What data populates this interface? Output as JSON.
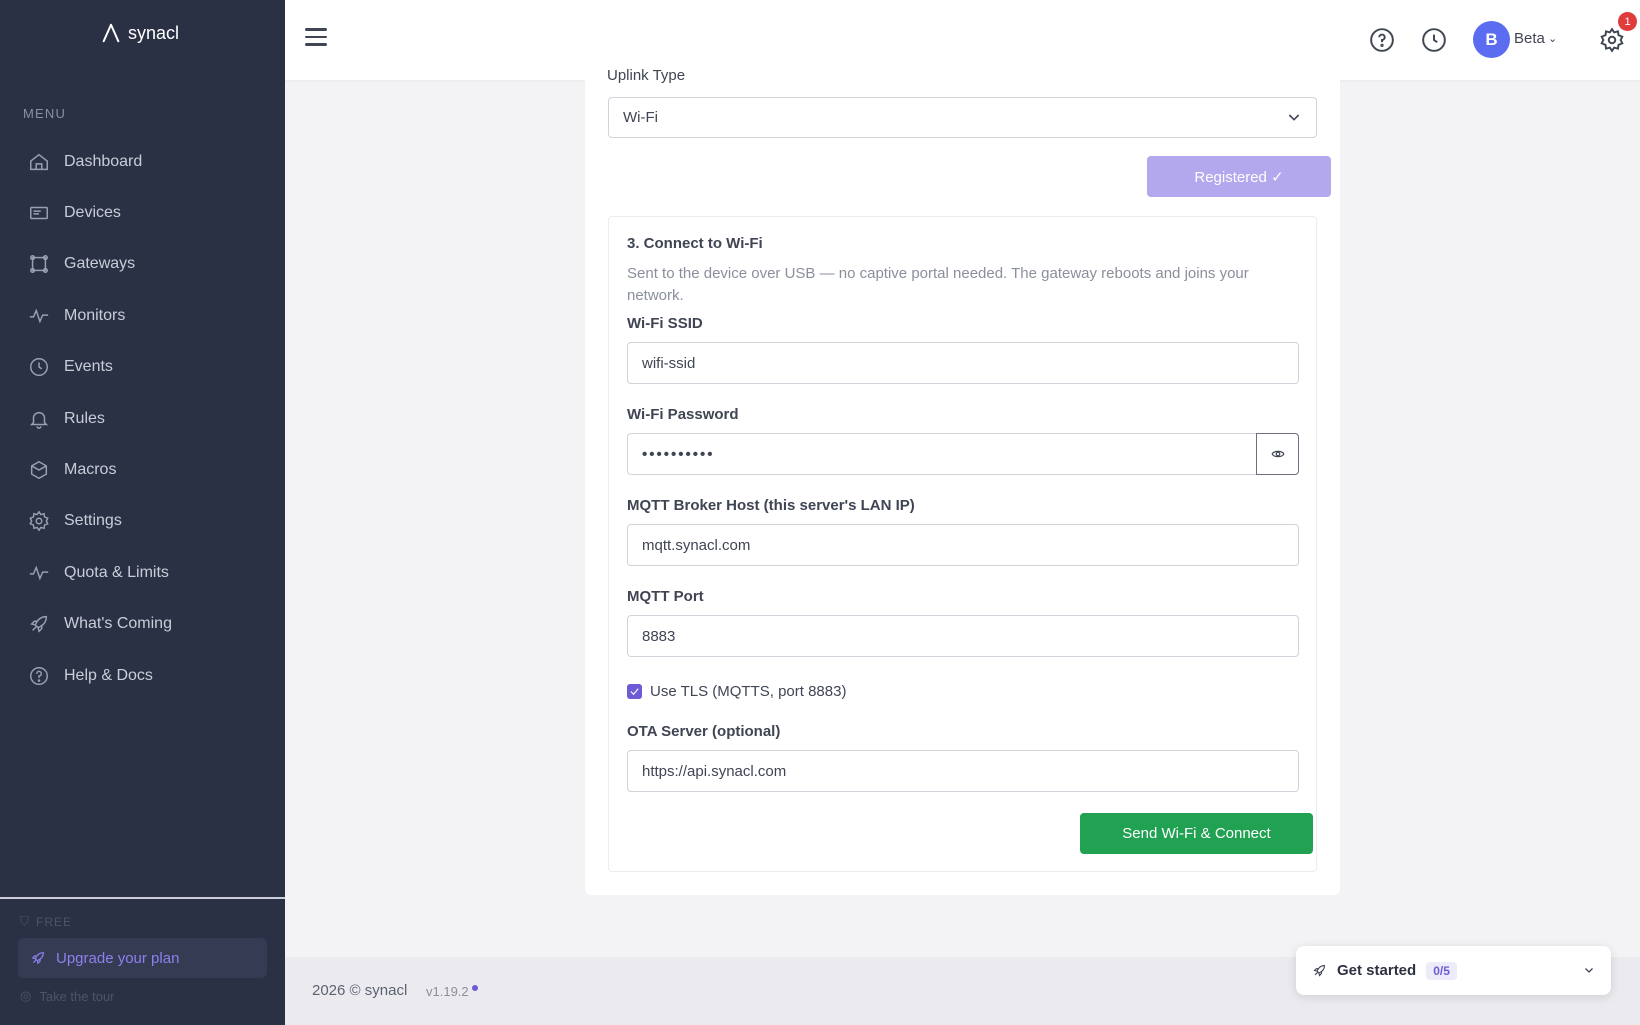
{
  "brand": {
    "name": "synacl"
  },
  "sidebar": {
    "menu_label": "MENU",
    "items": [
      {
        "label": "Dashboard",
        "icon": "home-icon"
      },
      {
        "label": "Devices",
        "icon": "devices-icon"
      },
      {
        "label": "Gateways",
        "icon": "gateway-icon"
      },
      {
        "label": "Monitors",
        "icon": "activity-icon"
      },
      {
        "label": "Events",
        "icon": "clock-icon"
      },
      {
        "label": "Rules",
        "icon": "bell-icon"
      },
      {
        "label": "Macros",
        "icon": "hexagon-icon"
      },
      {
        "label": "Settings",
        "icon": "gear-icon"
      },
      {
        "label": "Quota & Limits",
        "icon": "activity-icon"
      },
      {
        "label": "What's Coming",
        "icon": "rocket-icon"
      },
      {
        "label": "Help & Docs",
        "icon": "help-icon"
      }
    ],
    "plan_tier": "FREE",
    "upgrade_label": "Upgrade your plan",
    "tour_label": "Take the tour"
  },
  "topbar": {
    "user_initial": "B",
    "user_name": "Beta",
    "notification_count": "1"
  },
  "form": {
    "uplink_label": "Uplink Type",
    "uplink_value": "Wi-Fi",
    "registered_label": "Registered ✓",
    "step_title": "3. Connect to Wi-Fi",
    "step_desc": "Sent to the device over USB — no captive portal needed. The gateway reboots and joins your network.",
    "ssid_label": "Wi-Fi SSID",
    "ssid_value": "wifi-ssid",
    "password_label": "Wi-Fi Password",
    "password_value": "••••••••••",
    "broker_label": "MQTT Broker Host (this server's LAN IP)",
    "broker_value": "mqtt.synacl.com",
    "port_label": "MQTT Port",
    "port_value": "8883",
    "tls_label": "Use TLS (MQTTS, port 8883)",
    "tls_checked": true,
    "ota_label": "OTA Server (optional)",
    "ota_value": "https://api.synacl.com",
    "send_label": "Send Wi-Fi & Connect"
  },
  "footer": {
    "copyright": "2026 © synacl",
    "version": "v1.19.2"
  },
  "get_started": {
    "label": "Get started",
    "progress": "0/5"
  },
  "colors": {
    "sidebar_bg": "#2b3145",
    "accent": "#6c5bd4",
    "success": "#21a152",
    "registered": "#b3a8ee",
    "avatar": "#5b6cf0",
    "notification": "#e03c3c"
  }
}
